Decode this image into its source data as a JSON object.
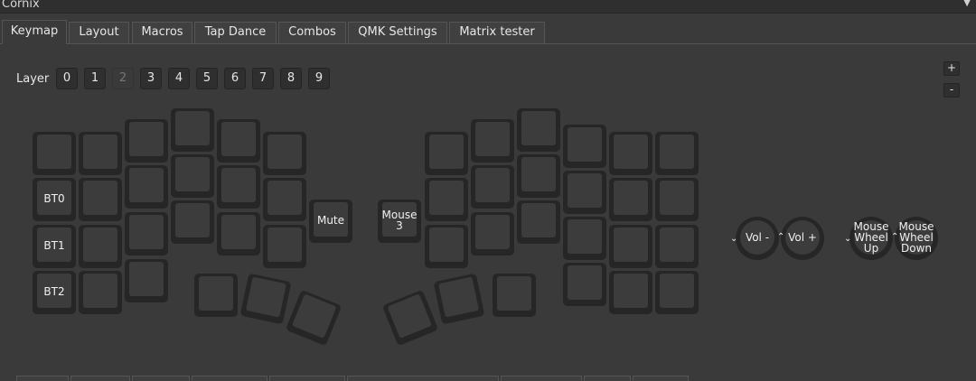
{
  "window": {
    "title": "Cornix"
  },
  "tabs": [
    "Keymap",
    "Layout",
    "Macros",
    "Tap Dance",
    "Combos",
    "QMK Settings",
    "Matrix tester"
  ],
  "layer": {
    "label": "Layer",
    "options": [
      "0",
      "1",
      "2",
      "3",
      "4",
      "5",
      "6",
      "7",
      "8",
      "9"
    ],
    "selected": "2"
  },
  "zoom": {
    "in": "+",
    "out": "-"
  },
  "keys": {
    "bt0": "BT0",
    "bt1": "BT1",
    "bt2": "BT2",
    "mute": "Mute",
    "mouse3": "Mouse\n3"
  },
  "encoders": {
    "left_ccw": "Vol -",
    "left_cw": "Vol +",
    "right_ccw": "Mouse\nWheel\nUp",
    "right_cw": "Mouse\nWheel\nDown"
  },
  "colors": {
    "background": "#3a3a3a",
    "key_outer": "#262626",
    "key_inner": "#3c3c3c"
  },
  "icons": {
    "encoder_ccw": "ccw-arrow-icon",
    "encoder_cw": "cw-arrow-icon",
    "window_menu": "chevron-down-icon"
  }
}
